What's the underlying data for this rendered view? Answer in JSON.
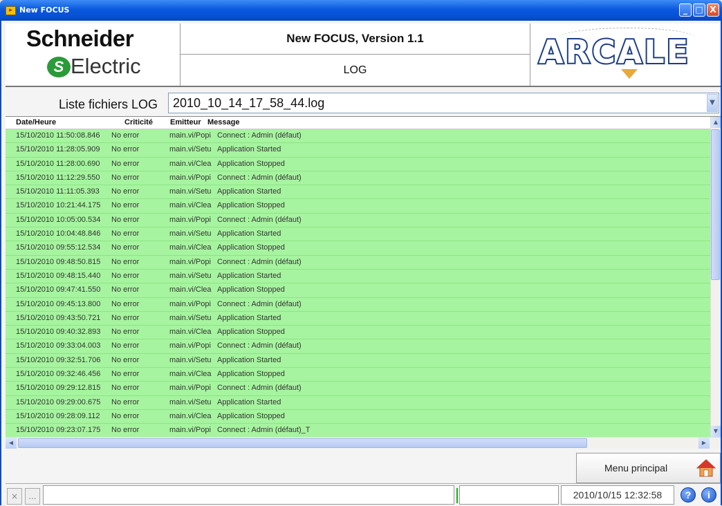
{
  "window": {
    "title": "New FOCUS",
    "controls": {
      "minimize": "_",
      "maximize": "□",
      "close": "X"
    }
  },
  "header": {
    "logo_left": {
      "word1": "Schneider",
      "word2": "Electric",
      "mark": "S"
    },
    "app_title": "New FOCUS, Version 1.1",
    "subtitle": "LOG",
    "logo_right": "ARCALE"
  },
  "file_picker": {
    "label": "Liste fichiers LOG",
    "selected": "2010_10_14_17_58_44.log"
  },
  "table": {
    "columns": [
      "Date/Heure",
      "Criticité",
      "Emitteur",
      "Message"
    ],
    "row_color": "#a6f49f",
    "rows": [
      {
        "date": "15/10/2010 11:50:08.846",
        "crit": "No error",
        "emit": "main.vi/Popi",
        "msg": "Connect :  Admin (défaut)"
      },
      {
        "date": "15/10/2010 11:28:05.909",
        "crit": "No error",
        "emit": "main.vi/Setu",
        "msg": "Application Started"
      },
      {
        "date": "15/10/2010 11:28:00.690",
        "crit": "No error",
        "emit": "main.vi/Clea",
        "msg": "Application Stopped"
      },
      {
        "date": "15/10/2010 11:12:29.550",
        "crit": "No error",
        "emit": "main.vi/Popi",
        "msg": "Connect :  Admin (défaut)"
      },
      {
        "date": "15/10/2010 11:11:05.393",
        "crit": "No error",
        "emit": "main.vi/Setu",
        "msg": "Application Started"
      },
      {
        "date": "15/10/2010 10:21:44.175",
        "crit": "No error",
        "emit": "main.vi/Clea",
        "msg": "Application Stopped"
      },
      {
        "date": "15/10/2010 10:05:00.534",
        "crit": "No error",
        "emit": "main.vi/Popi",
        "msg": "Connect :  Admin (défaut)"
      },
      {
        "date": "15/10/2010 10:04:48.846",
        "crit": "No error",
        "emit": "main.vi/Setu",
        "msg": "Application Started"
      },
      {
        "date": "15/10/2010 09:55:12.534",
        "crit": "No error",
        "emit": "main.vi/Clea",
        "msg": "Application Stopped"
      },
      {
        "date": "15/10/2010 09:48:50.815",
        "crit": "No error",
        "emit": "main.vi/Popi",
        "msg": "Connect :  Admin (défaut)"
      },
      {
        "date": "15/10/2010 09:48:15.440",
        "crit": "No error",
        "emit": "main.vi/Setu",
        "msg": "Application Started"
      },
      {
        "date": "15/10/2010 09:47:41.550",
        "crit": "No error",
        "emit": "main.vi/Clea",
        "msg": "Application Stopped"
      },
      {
        "date": "15/10/2010 09:45:13.800",
        "crit": "No error",
        "emit": "main.vi/Popi",
        "msg": "Connect :  Admin (défaut)"
      },
      {
        "date": "15/10/2010 09:43:50.721",
        "crit": "No error",
        "emit": "main.vi/Setu",
        "msg": "Application Started"
      },
      {
        "date": "15/10/2010 09:40:32.893",
        "crit": "No error",
        "emit": "main.vi/Clea",
        "msg": "Application Stopped"
      },
      {
        "date": "15/10/2010 09:33:04.003",
        "crit": "No error",
        "emit": "main.vi/Popi",
        "msg": "Connect :  Admin (défaut)"
      },
      {
        "date": "15/10/2010 09:32:51.706",
        "crit": "No error",
        "emit": "main.vi/Setu",
        "msg": "Application Started"
      },
      {
        "date": "15/10/2010 09:32:46.456",
        "crit": "No error",
        "emit": "main.vi/Clea",
        "msg": "Application Stopped"
      },
      {
        "date": "15/10/2010 09:29:12.815",
        "crit": "No error",
        "emit": "main.vi/Popi",
        "msg": "Connect :  Admin (défaut)"
      },
      {
        "date": "15/10/2010 09:29:00.675",
        "crit": "No error",
        "emit": "main.vi/Setu",
        "msg": "Application Started"
      },
      {
        "date": "15/10/2010 09:28:09.112",
        "crit": "No error",
        "emit": "main.vi/Clea",
        "msg": "Application Stopped"
      },
      {
        "date": "15/10/2010 09:23:07.175",
        "crit": "No error",
        "emit": "main.vi/Popi",
        "msg": "Connect :  Admin (défaut)_T"
      }
    ]
  },
  "footer": {
    "menu_button": "Menu principal",
    "status_buttons": [
      "×",
      "..."
    ],
    "datetime": "2010/10/15 12:32:58",
    "help_icon": "?",
    "info_icon": "i"
  }
}
